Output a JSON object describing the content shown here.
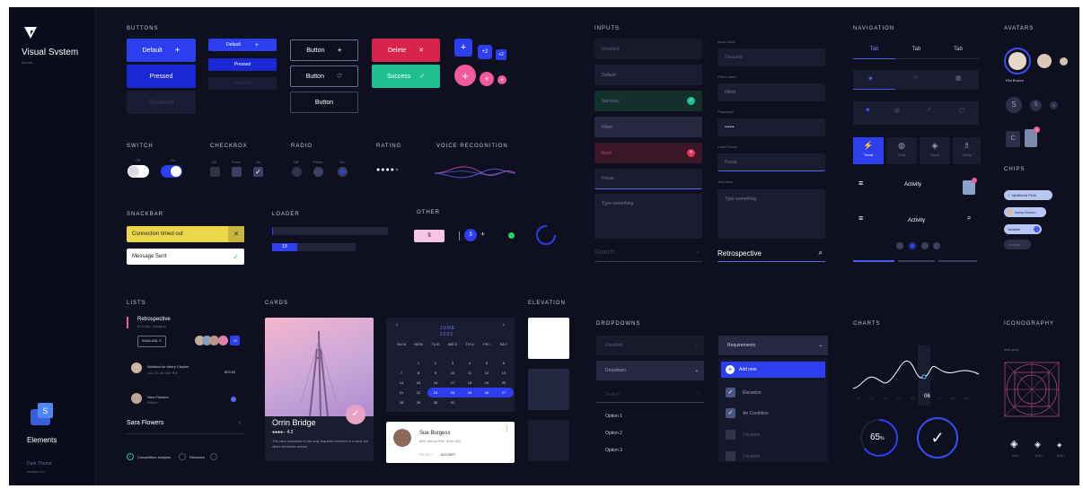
{
  "app": {
    "name": "Visual Svstem",
    "brand": "acrono",
    "footer_title": "Elements",
    "theme": "Dark Theme",
    "version": "version 1.0"
  },
  "sections": {
    "buttons": "BUTTONS",
    "inputs": "INPUTS",
    "navigation": "NAVIGATION",
    "avatars": "AVATARS",
    "switch": "SWITCH",
    "checkbox": "CHECKBOX",
    "radio": "RADIO",
    "rating": "RATING",
    "voice": "VOICE RECOGNITION",
    "chips": "CHIPS",
    "snackbar": "SNACKBAR",
    "loader": "LOADER",
    "other": "OTHER",
    "lists": "LISTS",
    "cards": "CARDS",
    "elevation": "ELEVATION",
    "dropdowns": "DROPDOWNS",
    "charts": "CHARTS",
    "iconography": "ICONOGRAPHY"
  },
  "buttons": {
    "default": "Default",
    "pressed": "Pressed",
    "disabled": "Disabled",
    "default_sm": "Default",
    "pressed_sm": "Pressed",
    "disabled_sm": "Disabled",
    "button": "Button",
    "delete": "Delete",
    "success": "Success",
    "badge": "+2"
  },
  "switch": {
    "off": "Off",
    "on": "On"
  },
  "checkbox": {
    "off": "Off",
    "press": "Press",
    "on": "On"
  },
  "radio": {
    "off": "Off",
    "press": "Press",
    "on": "On"
  },
  "snackbar": {
    "warning": "Connection timed out",
    "message": "Message Sent"
  },
  "loader": {
    "value": "10",
    "progress": 0.3
  },
  "other": {
    "price": "$",
    "step": "3"
  },
  "inputs": {
    "left": [
      "Disabled",
      "Default",
      "Success",
      "Filled",
      "Error",
      "Focus"
    ],
    "textarea": "Type something",
    "search": "Search",
    "right_labels": [
      "Input Label",
      "Filled Label",
      "Password",
      "Label Focus",
      "Text Area"
    ],
    "right_values": [
      "Disabled",
      "Filled",
      "••••••",
      "Focus"
    ],
    "right_textarea": "Type something",
    "retro": "Retrospective"
  },
  "navigation": {
    "tabs": [
      "Tab",
      "Tab",
      "Tab"
    ],
    "bottom_labels": [
      "Trend",
      "Chat",
      "Stock",
      "Study"
    ],
    "activity": "Activity"
  },
  "avatars": {
    "name": "Ella Bowen",
    "s": "S",
    "c": "C",
    "badge": "4"
  },
  "chips": [
    "Additional Field",
    "Avery Bowen",
    "Variable",
    "Inactive"
  ],
  "lists": {
    "title": "Retrospective",
    "subtitle": "at 5:30p, Hangout",
    "chip": "AVAILABL E",
    "badge": "+2",
    "n_line1": "Notation  for Avery Clayton",
    "n_time": "Jun 22, at 4:30 PM",
    "n_amount": "$23.50",
    "sara": "Sara Flowers",
    "sara_sub": "Online",
    "sara2": "Sara Flowers",
    "check1": "Competition analysis",
    "check2": "Research"
  },
  "card": {
    "title": "Orrin Bridge",
    "rating": "4.2",
    "body": "The card container is the only required element in a card. All other elements shown"
  },
  "calendar": {
    "month": "JUNE",
    "year": "2020",
    "days": [
      "SU N",
      "MON",
      "TU E",
      "WE D",
      "TH U",
      "FR I",
      "SA T"
    ],
    "rows": [
      [
        "",
        "1",
        "2",
        "3",
        "4",
        "5",
        "6"
      ],
      [
        "7",
        "8",
        "9",
        "10",
        "11",
        "12",
        "13"
      ],
      [
        "14",
        "15",
        "16",
        "17",
        "18",
        "19",
        "20"
      ],
      [
        "21",
        "22",
        "23",
        "24",
        "25",
        "26",
        "27"
      ],
      [
        "28",
        "29",
        "30",
        "31",
        "",
        "",
        ""
      ]
    ]
  },
  "contact": {
    "name": "Sue Burgess",
    "address": "885 Jamya Pike Suite 552",
    "reject": "REJECT",
    "accept": "ACCEPT"
  },
  "dropdowns": {
    "left": [
      "Disabled",
      "Dropdown",
      "Search"
    ],
    "options": [
      "Option 1",
      "Option 2",
      "Option 3"
    ],
    "right_head": "Requirements",
    "add": "Add new",
    "items": [
      "Elevation",
      "Air Condition",
      "Disabled",
      "Disabled"
    ]
  },
  "charts": {
    "labels": [
      "01",
      "02",
      "03",
      "04",
      "05",
      "06",
      "07",
      "08",
      "09"
    ],
    "highlight": "06",
    "percent": "65",
    "percent_sign": "%",
    "donut_value": 0.65
  },
  "iconography": {
    "label": "auto-play",
    "icon_labels": [
      "Icon",
      "Icon",
      "Icon"
    ]
  }
}
